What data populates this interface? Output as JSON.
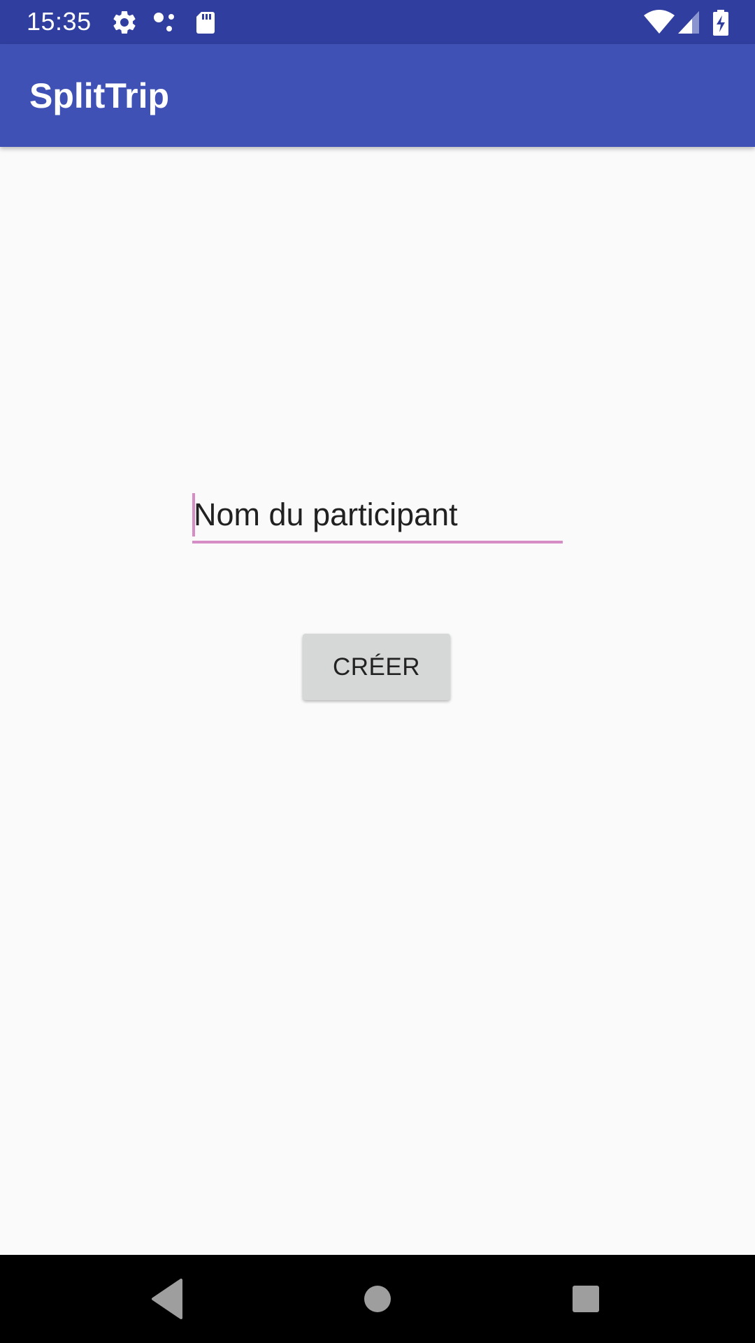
{
  "status_bar": {
    "time": "15:35",
    "left_icons": [
      "gear-icon",
      "dots-icon",
      "sd-card-icon"
    ],
    "right_icons": [
      "wifi-icon",
      "cell-signal-icon",
      "battery-charging-icon"
    ]
  },
  "app_bar": {
    "title": "SplitTrip"
  },
  "form": {
    "name_placeholder": "Nom du participant",
    "name_value": "",
    "create_label": "CRÉER"
  },
  "nav_bar": {
    "buttons": [
      "back-icon",
      "home-icon",
      "recents-icon"
    ]
  },
  "colors": {
    "status_bar": "#303f9f",
    "app_bar": "#3f51b5",
    "accent": "#d68cc5",
    "background": "#fafafa",
    "button": "#d6d7d7"
  }
}
